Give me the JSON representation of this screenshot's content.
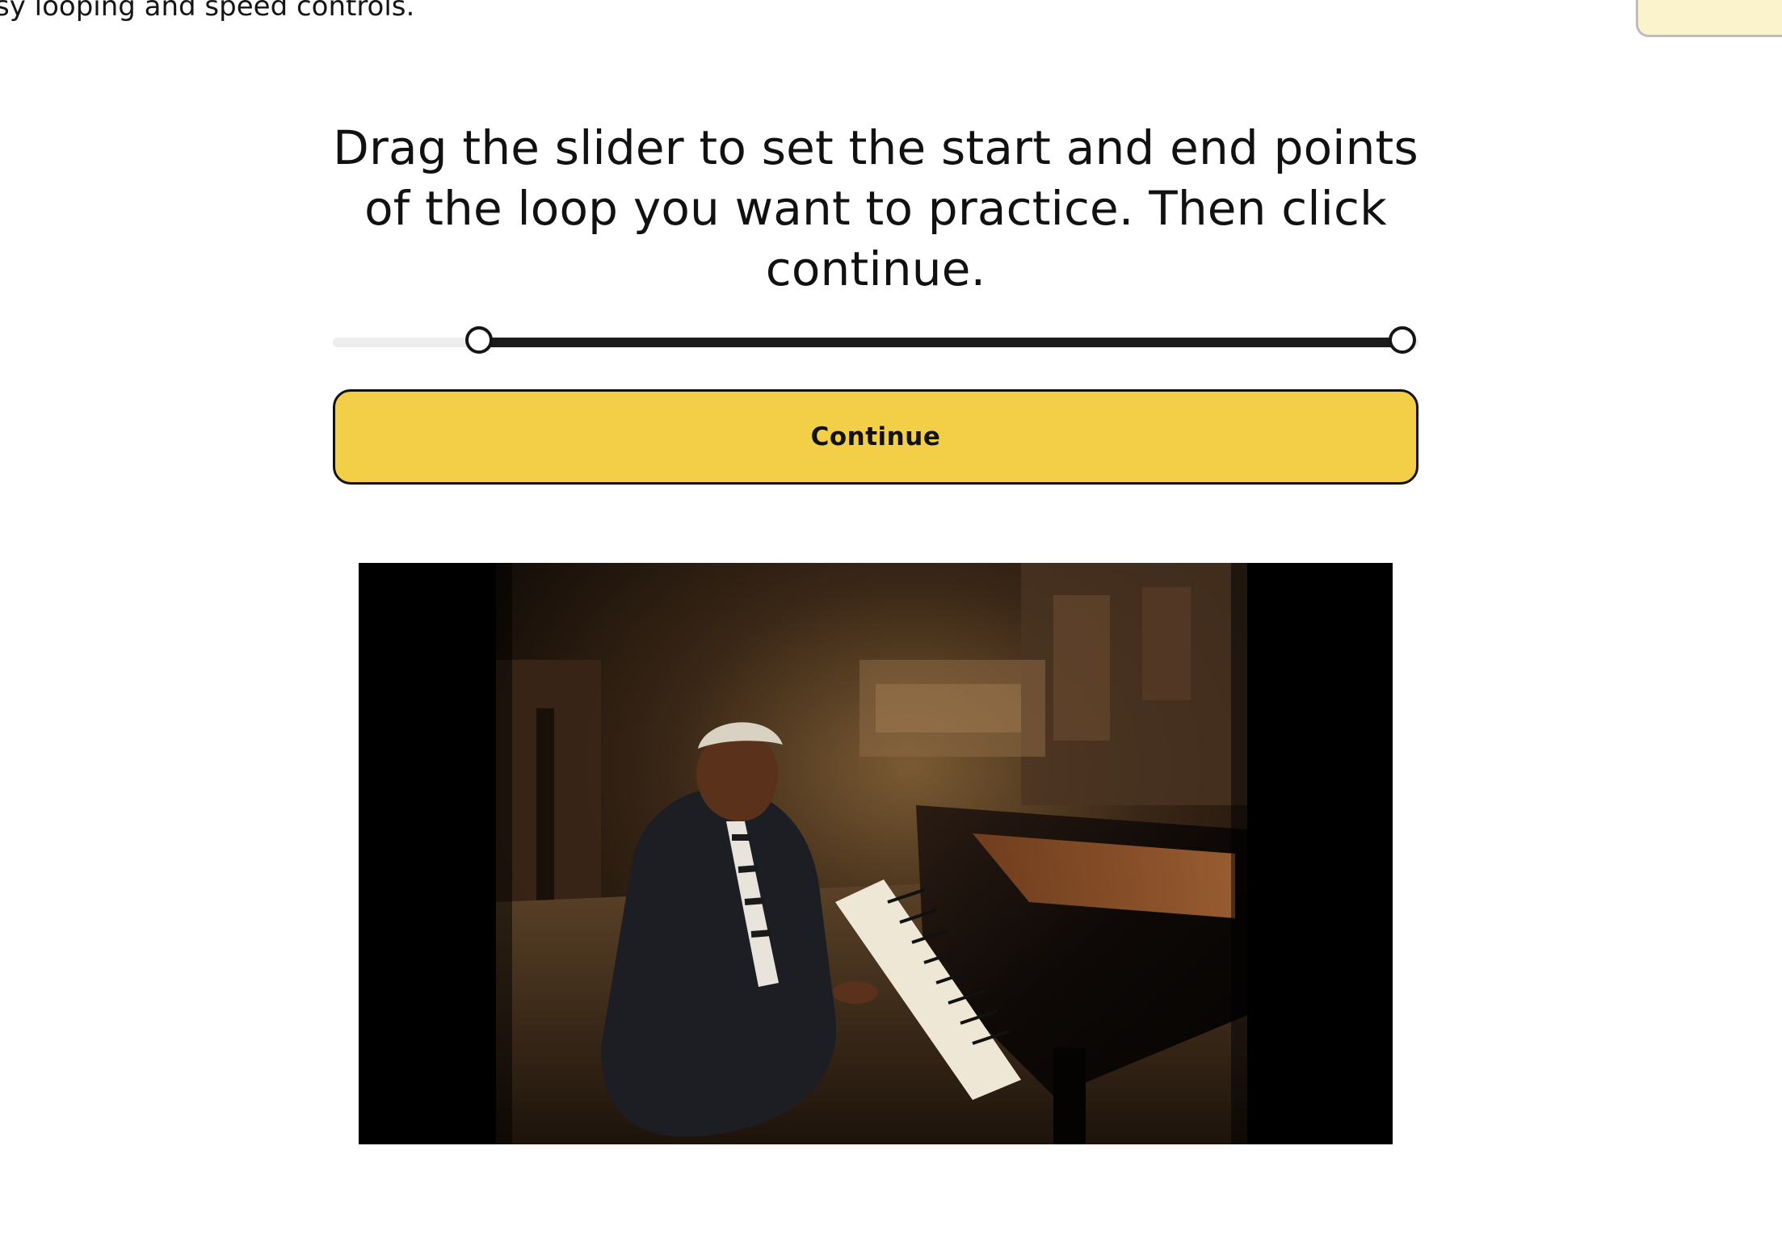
{
  "header": {
    "subtitle": "sy looping and speed controls."
  },
  "instruction": {
    "text": "Drag the slider to set the start and end points of the loop you want to practice. Then click continue."
  },
  "loop_slider": {
    "start": 0.135,
    "end": 0.985
  },
  "continue_button": {
    "label": "Continue"
  },
  "colors": {
    "accent_yellow": "#f3cf48",
    "pale_yellow": "#fbf3cc",
    "track_dark": "#1b1b1b",
    "track_light": "#ededed"
  },
  "video": {
    "scene": "man seated at grand piano"
  }
}
